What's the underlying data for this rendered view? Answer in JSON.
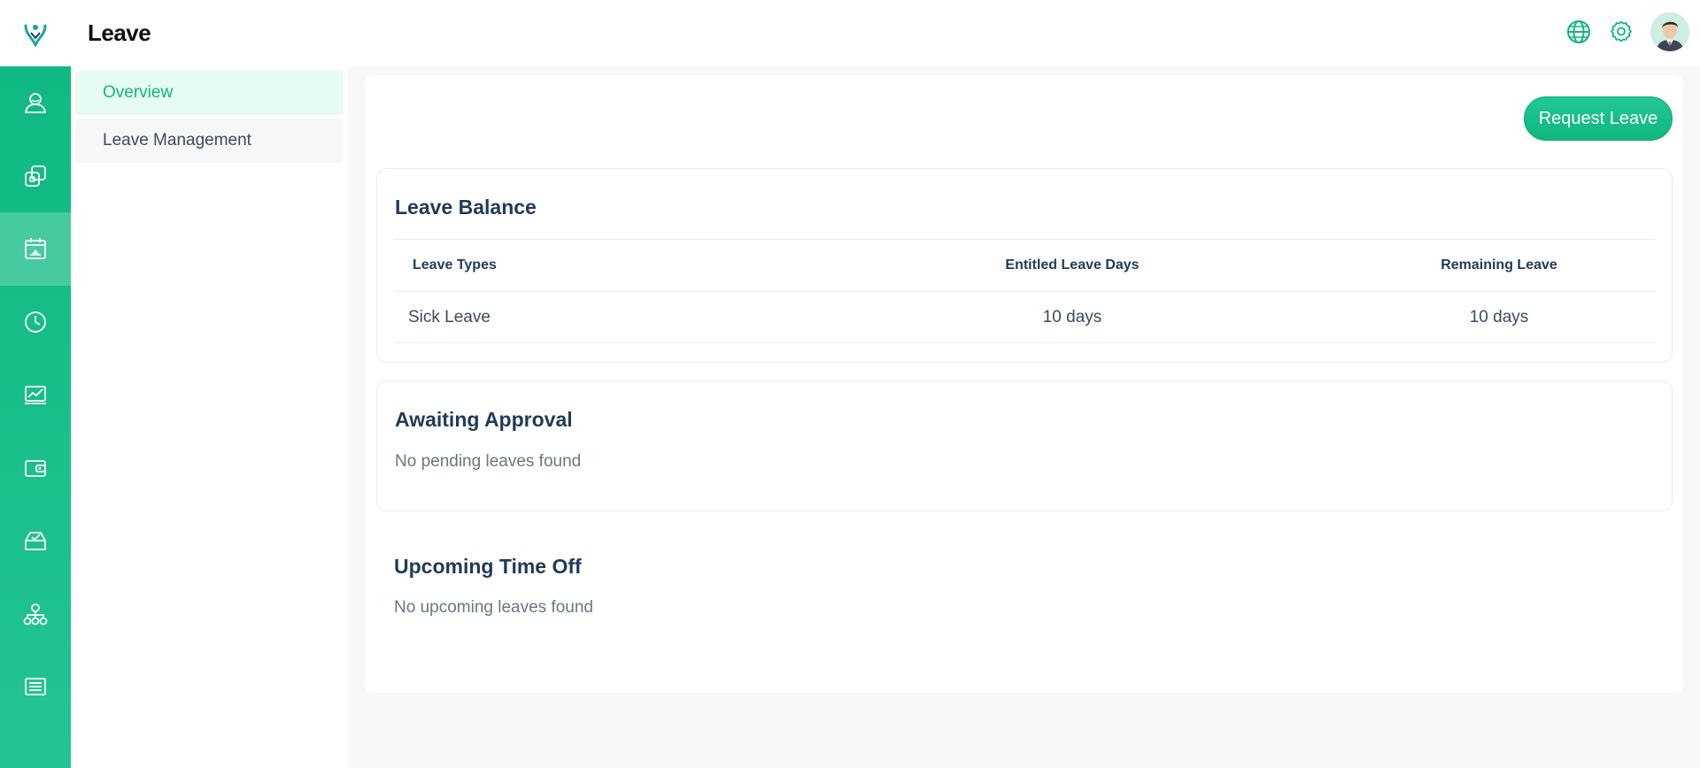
{
  "header": {
    "title": "Leave",
    "logo_icon": "tree-logo-icon",
    "actions": [
      {
        "name": "globe-icon"
      },
      {
        "name": "gear-icon"
      }
    ],
    "avatar_icon": "user-avatar"
  },
  "rail": {
    "items": [
      {
        "icon": "user-profile-icon",
        "active": false
      },
      {
        "icon": "copy-documents-icon",
        "active": false
      },
      {
        "icon": "calendar-icon",
        "active": true
      },
      {
        "icon": "clock-icon",
        "active": false
      },
      {
        "icon": "chart-monitor-icon",
        "active": false
      },
      {
        "icon": "wallet-icon",
        "active": false
      },
      {
        "icon": "inbox-check-icon",
        "active": false
      },
      {
        "icon": "org-structure-icon",
        "active": false
      },
      {
        "icon": "list-icon",
        "active": false
      }
    ]
  },
  "subnav": {
    "items": [
      {
        "label": "Overview",
        "active": true
      },
      {
        "label": "Leave Management",
        "active": false
      }
    ]
  },
  "main": {
    "request_button": "Request Leave",
    "leave_balance": {
      "title": "Leave Balance",
      "columns": [
        "Leave Types",
        "Entitled Leave Days",
        "Remaining Leave"
      ],
      "rows": [
        [
          "Sick Leave",
          "10 days",
          "10 days"
        ]
      ]
    },
    "awaiting_approval": {
      "title": "Awaiting Approval",
      "empty_text": "No pending leaves found"
    },
    "upcoming_time_off": {
      "title": "Upcoming Time Off",
      "empty_text": "No upcoming leaves found"
    }
  },
  "colors": {
    "accent": "#10b67e",
    "heading": "#1f3b5a",
    "muted": "#6b7684"
  }
}
